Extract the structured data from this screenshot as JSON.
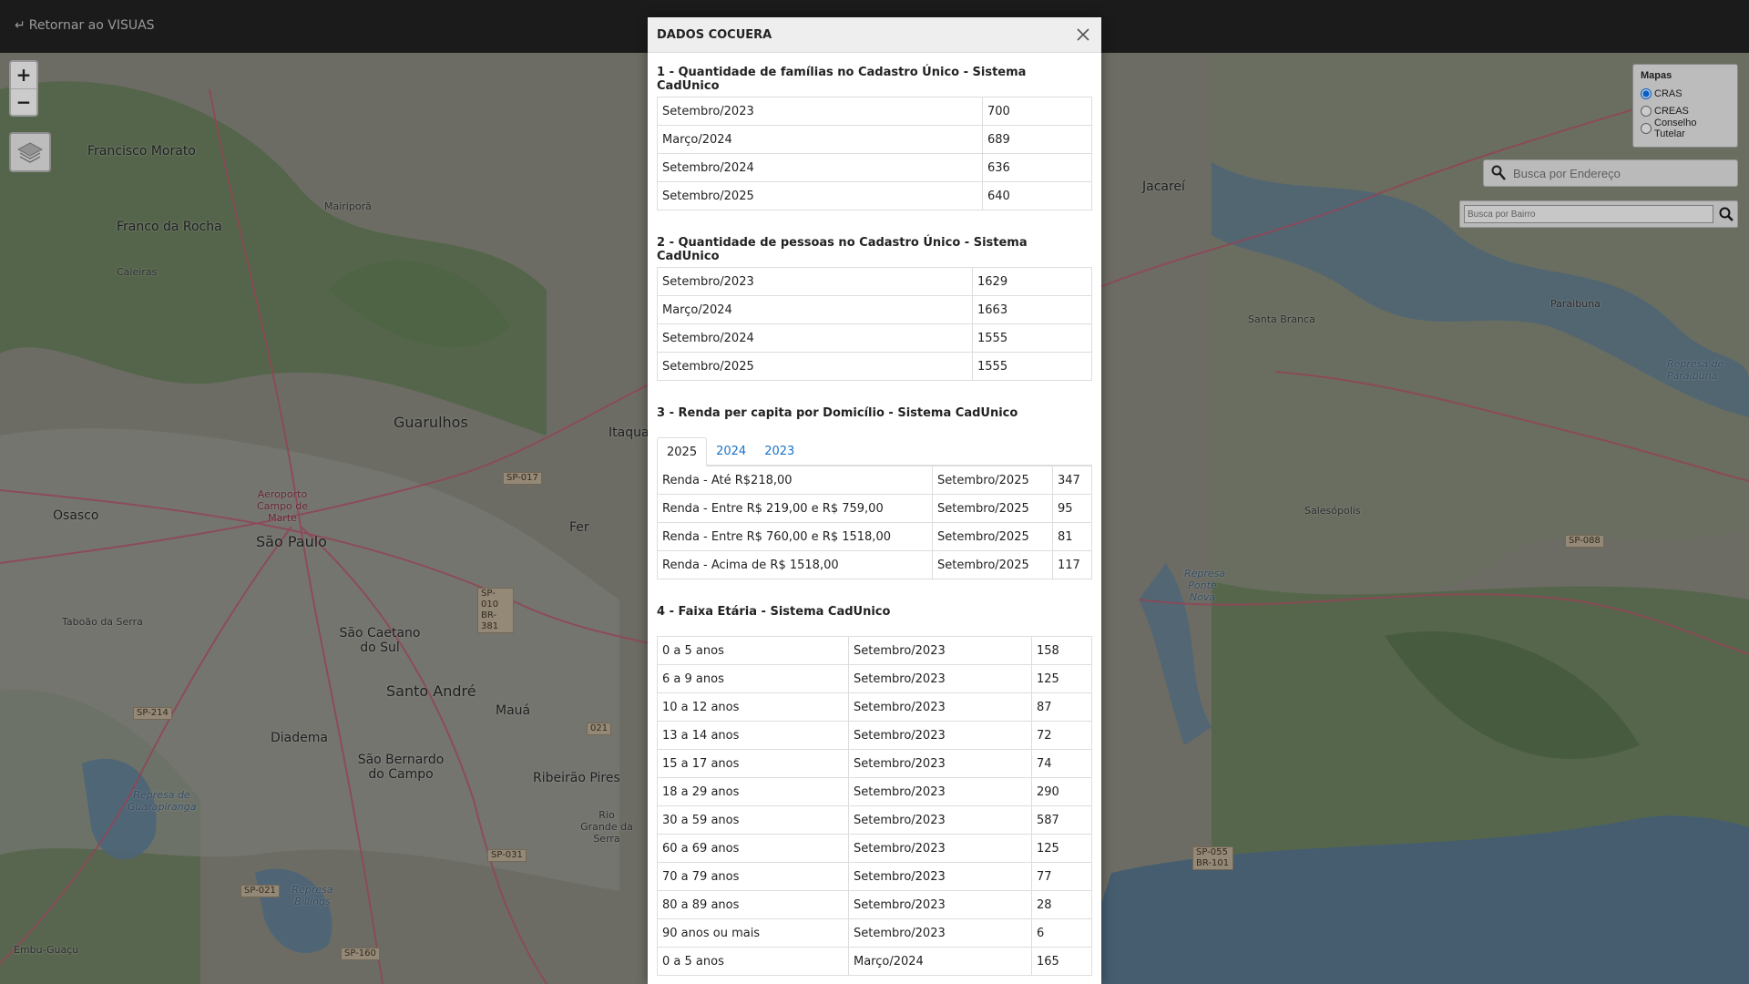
{
  "topbar": {
    "back_icon": "return-arrow-icon",
    "back_label": "Retornar ao VISUAS"
  },
  "map": {
    "places": [
      "Francisco Morato",
      "Franco da Rocha",
      "Caieiras",
      "Mairiporã",
      "Guarulhos",
      "Itaqua",
      "Osasco",
      "São Paulo",
      "Taboão da Serra",
      "São Caetano do Sul",
      "Santo André",
      "Mauá",
      "Diadema",
      "São Bernardo do Campo",
      "Ribeirão Pires",
      "Rio Grande da Serra",
      "Embu-Guaçu",
      "Jacareí",
      "Santa Branca",
      "Paraibuna",
      "Salesópolis",
      "Fer",
      "Aeroporto Campo de Marte"
    ],
    "shields": [
      "SP-017",
      "SP-010 BR-381",
      "SP-214",
      "SP-031",
      "SP-021",
      "SP-160",
      "SP-088",
      "SP-055 BR-101",
      "021"
    ],
    "waters": [
      "Represa de Paraibuna",
      "Represa Ponte Nova",
      "Represa de Guarapiranga",
      "Represa Billings"
    ]
  },
  "zoom": {
    "in": "+",
    "out": "−"
  },
  "layers": {
    "icon": "layers-icon"
  },
  "mapas_panel": {
    "title": "Mapas",
    "options": [
      "CRAS",
      "CREAS",
      "Conselho Tutelar"
    ],
    "selected": "CRAS"
  },
  "search": {
    "address_placeholder": "Busca por Endereço",
    "bairro_placeholder": "Busca por Bairro"
  },
  "modal": {
    "title": "DADOS COCUERA",
    "section1": {
      "title": "1 - Quantidade de famílias no Cadastro Único - Sistema CadUnico",
      "rows": [
        {
          "period": "Setembro/2023",
          "value": "700"
        },
        {
          "period": "Março/2024",
          "value": "689"
        },
        {
          "period": "Setembro/2024",
          "value": "636"
        },
        {
          "period": "Setembro/2025",
          "value": "640"
        }
      ]
    },
    "section2": {
      "title": "2 - Quantidade de pessoas no Cadastro Único - Sistema CadUnico",
      "rows": [
        {
          "period": "Setembro/2023",
          "value": "1629"
        },
        {
          "period": "Março/2024",
          "value": "1663"
        },
        {
          "period": "Setembro/2024",
          "value": "1555"
        },
        {
          "period": "Setembro/2025",
          "value": "1555"
        }
      ]
    },
    "section3": {
      "title": "3 - Renda per capita por Domicílio - Sistema CadUnico",
      "tabs": [
        "2025",
        "2024",
        "2023"
      ],
      "active_tab": "2025",
      "rows": [
        {
          "label": "Renda - Até R$218,00",
          "period": "Setembro/2025",
          "value": "347"
        },
        {
          "label": "Renda - Entre R$ 219,00 e R$ 759,00",
          "period": "Setembro/2025",
          "value": "95"
        },
        {
          "label": "Renda - Entre R$ 760,00 e R$ 1518,00",
          "period": "Setembro/2025",
          "value": "81"
        },
        {
          "label": "Renda - Acima de R$ 1518,00",
          "period": "Setembro/2025",
          "value": "117"
        }
      ]
    },
    "section4": {
      "title": "4 - Faixa Etária - Sistema CadUnico",
      "rows": [
        {
          "label": "0 a 5 anos",
          "period": "Setembro/2023",
          "value": "158"
        },
        {
          "label": "6 a 9 anos",
          "period": "Setembro/2023",
          "value": "125"
        },
        {
          "label": "10 a 12 anos",
          "period": "Setembro/2023",
          "value": "87"
        },
        {
          "label": "13 a 14 anos",
          "period": "Setembro/2023",
          "value": "72"
        },
        {
          "label": "15 a 17 anos",
          "period": "Setembro/2023",
          "value": "74"
        },
        {
          "label": "18 a 29 anos",
          "period": "Setembro/2023",
          "value": "290"
        },
        {
          "label": "30 a 59 anos",
          "period": "Setembro/2023",
          "value": "587"
        },
        {
          "label": "60 a 69 anos",
          "period": "Setembro/2023",
          "value": "125"
        },
        {
          "label": "70 a 79 anos",
          "period": "Setembro/2023",
          "value": "77"
        },
        {
          "label": "80 a 89 anos",
          "period": "Setembro/2023",
          "value": "28"
        },
        {
          "label": "90 anos ou mais",
          "period": "Setembro/2023",
          "value": "6"
        },
        {
          "label": "0 a 5 anos",
          "period": "Março/2024",
          "value": "165"
        }
      ]
    }
  }
}
